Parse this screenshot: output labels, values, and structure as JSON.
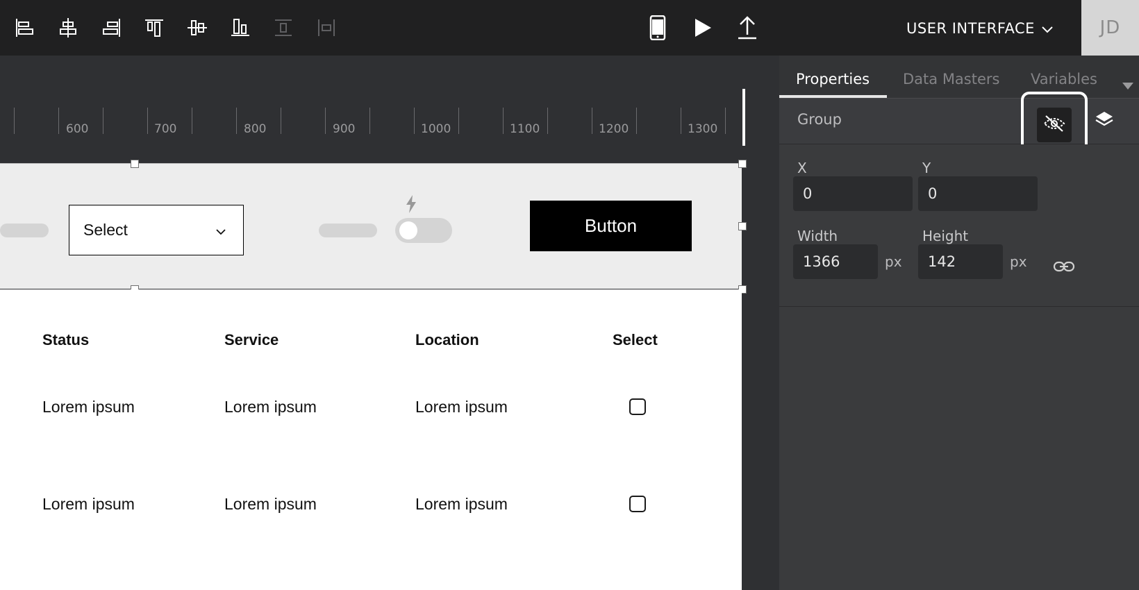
{
  "toolbar": {
    "align_tools": [
      "align-left-icon",
      "align-center-icon",
      "align-right-icon",
      "align-top-icon",
      "align-middle-icon",
      "align-bottom-icon",
      "distribute-vertical-icon",
      "distribute-horizontal-icon"
    ],
    "device_icon": "mobile-device-icon",
    "play_icon": "play-icon",
    "upload_icon": "upload-icon",
    "menu_title": "USER INTERFACE",
    "avatar_initials": "JD"
  },
  "ruler": {
    "labels": [
      "600",
      "700",
      "800",
      "900",
      "1000",
      "1100",
      "1200",
      "1300"
    ]
  },
  "canvas": {
    "select_label": "Select",
    "button_label": "Button",
    "table": {
      "headers": [
        "Status",
        "Service",
        "Location",
        "Select"
      ],
      "rows": [
        [
          "Lorem ipsum",
          "Lorem ipsum",
          "Lorem ipsum",
          ""
        ],
        [
          "Lorem ipsum",
          "Lorem ipsum",
          "Lorem ipsum",
          ""
        ]
      ]
    }
  },
  "panel": {
    "tabs": [
      "Properties",
      "Data Masters",
      "Variables"
    ],
    "active_tab": "Properties",
    "group_label": "Group",
    "x_label": "X",
    "y_label": "Y",
    "x_value": "0",
    "y_value": "0",
    "width_label": "Width",
    "height_label": "Height",
    "width_value": "1366",
    "height_value": "142",
    "unit": "px"
  },
  "colors": {
    "toolbar_bg": "#202021",
    "canvas_bg": "#2f3033",
    "panel_bg": "#3a3b3d",
    "group_bg": "#ededed",
    "button_bg": "#000000"
  }
}
